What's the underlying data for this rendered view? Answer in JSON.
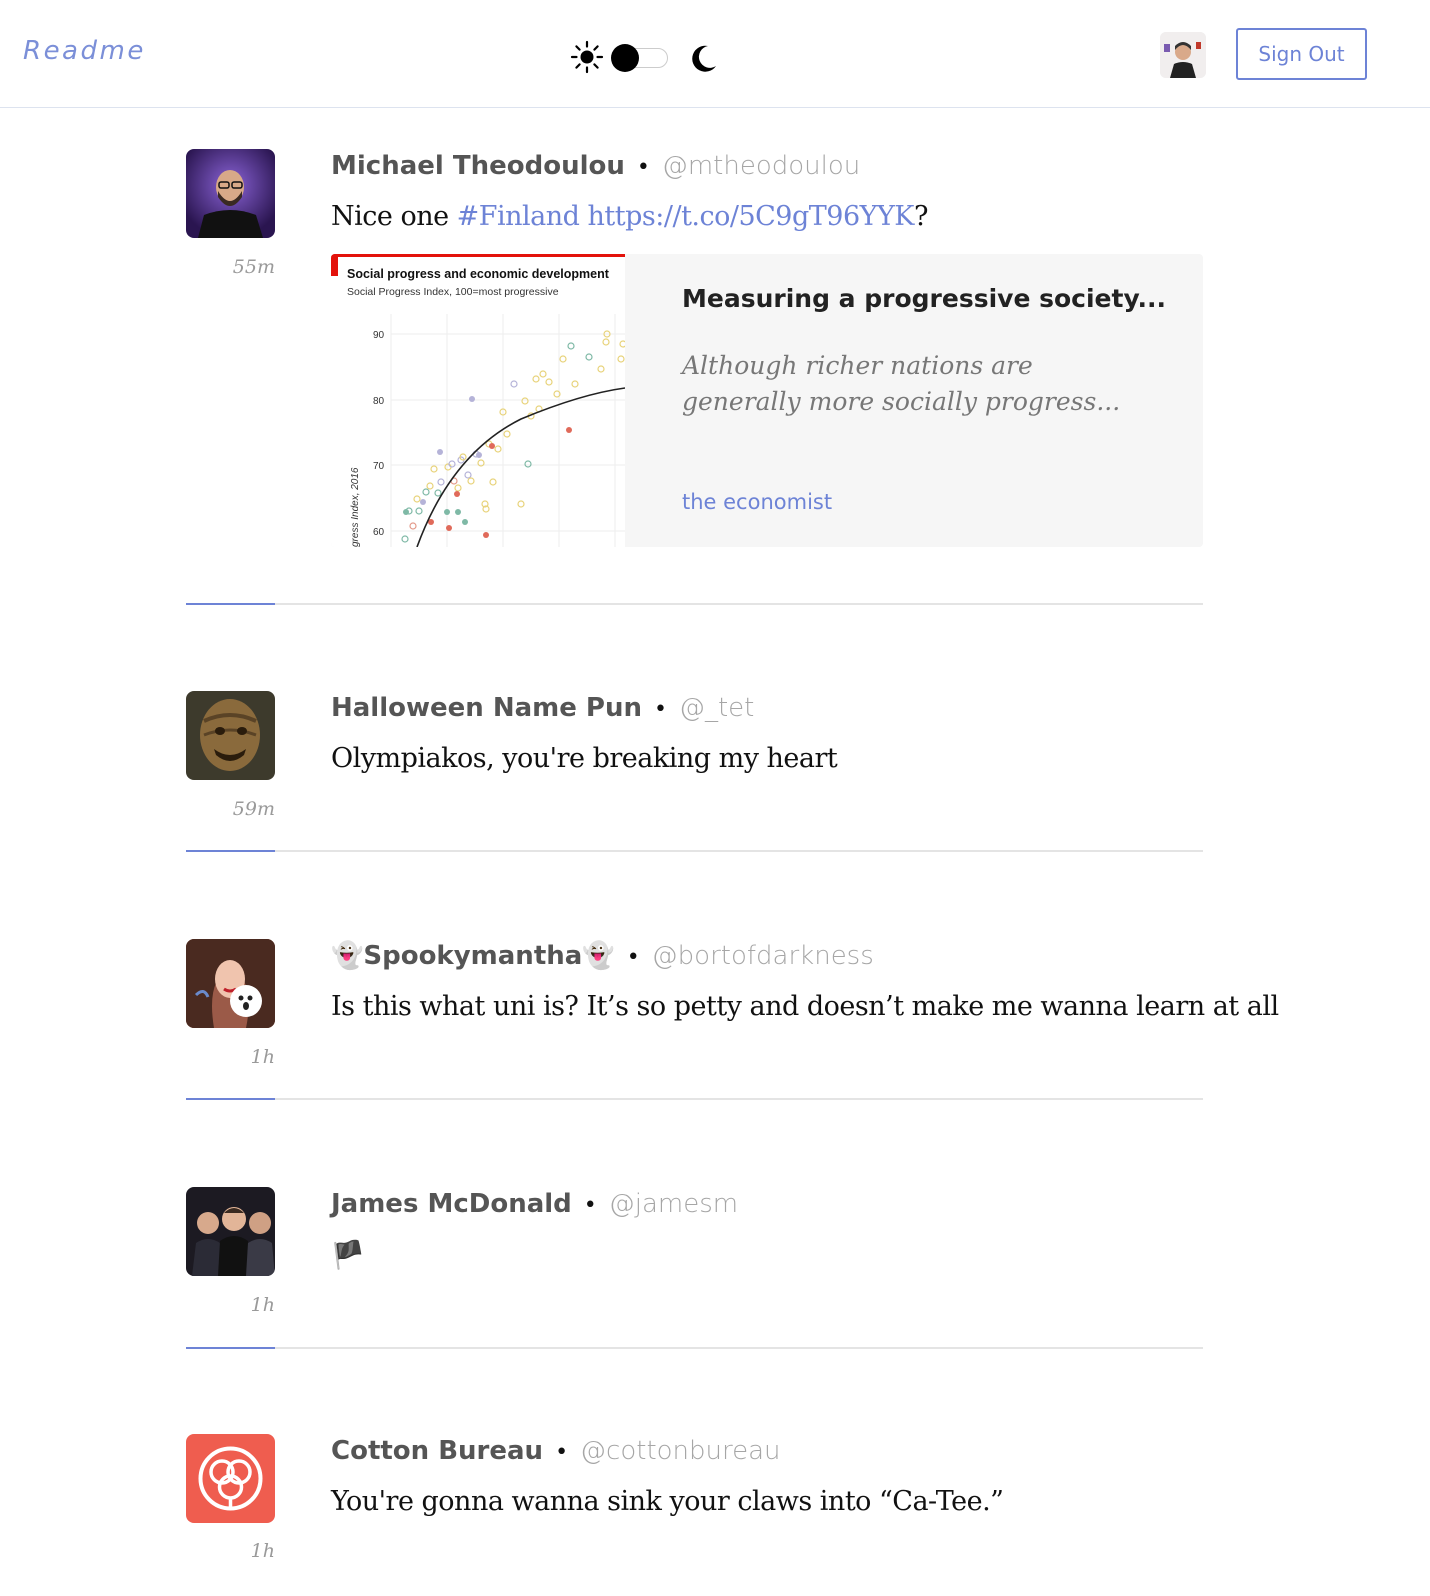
{
  "header": {
    "logo": "Readme",
    "sign_out_label": "Sign Out"
  },
  "colors": {
    "accent": "#6d83d6",
    "logo": "#7b8fd8",
    "card_bg": "#f6f6f6"
  },
  "icons": {
    "sun": "sun-icon",
    "moon": "moon-icon",
    "toggle": "theme-toggle"
  },
  "tweets": [
    {
      "name": "Michael Theodoulou",
      "handle": "@mtheodoulou",
      "text_prefix": "Nice one ",
      "hashtag": "#Finland",
      "link": "https://t.co/5C9gT96YYK",
      "text_suffix": "?",
      "time": "55m",
      "card": {
        "title": "Measuring a progressive society...",
        "description": "Although richer nations are generally more socially progress...",
        "source": "the economist",
        "thumb_title": "Social progress and economic development",
        "thumb_subtitle": "Social Progress Index, 100=most progressive",
        "thumb_ylabel": "gress Index, 2016",
        "thumb_ticks": [
          "90",
          "80",
          "70",
          "60"
        ]
      }
    },
    {
      "name": "Halloween Name Pun",
      "handle": "@_tet",
      "text": "Olympiakos, you're breaking my heart",
      "time": "59m"
    },
    {
      "name": "👻Spookymantha👻",
      "handle": "@bortofdarkness",
      "text": "Is this what uni is? It’s so petty and doesn’t make me wanna learn at all",
      "time": "1h"
    },
    {
      "name": "James McDonald",
      "handle": "@jamesm",
      "text": "🏴",
      "time": "1h"
    },
    {
      "name": "Cotton Bureau",
      "handle": "@cottonbureau",
      "text": "You're gonna wanna sink your claws into “Ca-Tee.”",
      "time": "1h"
    }
  ]
}
